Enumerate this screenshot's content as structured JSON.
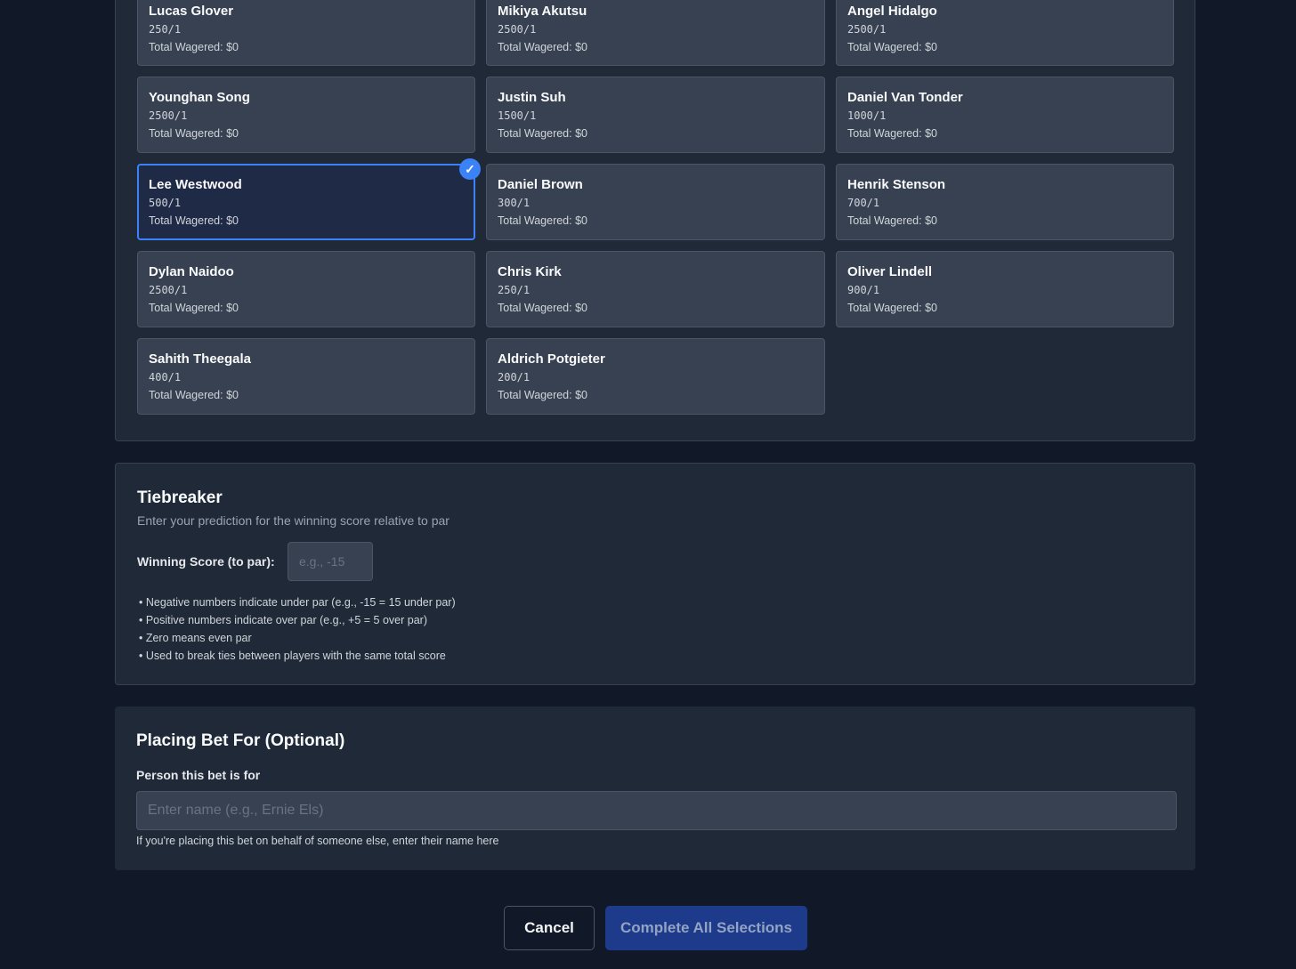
{
  "players": [
    {
      "name": "Lucas Glover",
      "odds": "250/1",
      "wagered": "Total Wagered: $0",
      "selected": false
    },
    {
      "name": "Mikiya Akutsu",
      "odds": "2500/1",
      "wagered": "Total Wagered: $0",
      "selected": false
    },
    {
      "name": "Angel Hidalgo",
      "odds": "2500/1",
      "wagered": "Total Wagered: $0",
      "selected": false
    },
    {
      "name": "Younghan Song",
      "odds": "2500/1",
      "wagered": "Total Wagered: $0",
      "selected": false
    },
    {
      "name": "Justin Suh",
      "odds": "1500/1",
      "wagered": "Total Wagered: $0",
      "selected": false
    },
    {
      "name": "Daniel Van Tonder",
      "odds": "1000/1",
      "wagered": "Total Wagered: $0",
      "selected": false
    },
    {
      "name": "Lee Westwood",
      "odds": "500/1",
      "wagered": "Total Wagered: $0",
      "selected": true
    },
    {
      "name": "Daniel Brown",
      "odds": "300/1",
      "wagered": "Total Wagered: $0",
      "selected": false
    },
    {
      "name": "Henrik Stenson",
      "odds": "700/1",
      "wagered": "Total Wagered: $0",
      "selected": false
    },
    {
      "name": "Dylan Naidoo",
      "odds": "2500/1",
      "wagered": "Total Wagered: $0",
      "selected": false
    },
    {
      "name": "Chris Kirk",
      "odds": "250/1",
      "wagered": "Total Wagered: $0",
      "selected": false
    },
    {
      "name": "Oliver Lindell",
      "odds": "900/1",
      "wagered": "Total Wagered: $0",
      "selected": false
    },
    {
      "name": "Sahith Theegala",
      "odds": "400/1",
      "wagered": "Total Wagered: $0",
      "selected": false
    },
    {
      "name": "Aldrich Potgieter",
      "odds": "200/1",
      "wagered": "Total Wagered: $0",
      "selected": false
    }
  ],
  "tiebreaker": {
    "title": "Tiebreaker",
    "subtitle": "Enter your prediction for the winning score relative to par",
    "label": "Winning Score (to par):",
    "placeholder": "e.g., -15",
    "value": "",
    "notes": [
      "• Negative numbers indicate under par (e.g., -15 = 15 under par)",
      "• Positive numbers indicate over par (e.g., +5 = 5 over par)",
      "• Zero means even par",
      "• Used to break ties between players with the same total score"
    ]
  },
  "placing_for": {
    "title": "Placing Bet For (Optional)",
    "label": "Person this bet is for",
    "placeholder": "Enter name (e.g., Ernie Els)",
    "value": "",
    "hint": "If you're placing this bet on behalf of someone else, enter their name here"
  },
  "actions": {
    "cancel_label": "Cancel",
    "complete_label": "Complete All Selections"
  },
  "selected_check": "✓",
  "colors": {
    "accent": "#3b82f6",
    "background": "#111827",
    "panel": "#1f2937",
    "card": "#374151"
  }
}
